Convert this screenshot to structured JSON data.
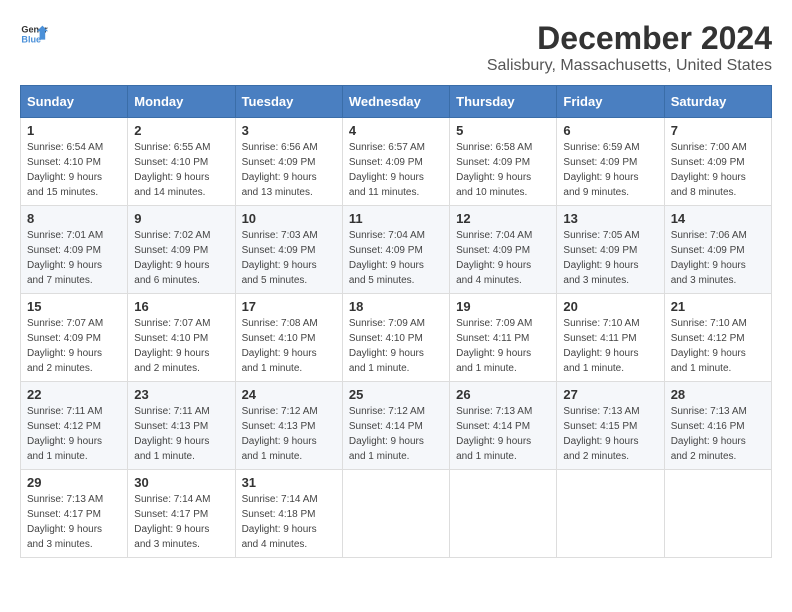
{
  "logo": {
    "line1": "General",
    "line2": "Blue"
  },
  "title": "December 2024",
  "subtitle": "Salisbury, Massachusetts, United States",
  "days_header": [
    "Sunday",
    "Monday",
    "Tuesday",
    "Wednesday",
    "Thursday",
    "Friday",
    "Saturday"
  ],
  "weeks": [
    [
      {
        "day": "1",
        "sunrise": "6:54 AM",
        "sunset": "4:10 PM",
        "daylight": "9 hours and 15 minutes."
      },
      {
        "day": "2",
        "sunrise": "6:55 AM",
        "sunset": "4:10 PM",
        "daylight": "9 hours and 14 minutes."
      },
      {
        "day": "3",
        "sunrise": "6:56 AM",
        "sunset": "4:09 PM",
        "daylight": "9 hours and 13 minutes."
      },
      {
        "day": "4",
        "sunrise": "6:57 AM",
        "sunset": "4:09 PM",
        "daylight": "9 hours and 11 minutes."
      },
      {
        "day": "5",
        "sunrise": "6:58 AM",
        "sunset": "4:09 PM",
        "daylight": "9 hours and 10 minutes."
      },
      {
        "day": "6",
        "sunrise": "6:59 AM",
        "sunset": "4:09 PM",
        "daylight": "9 hours and 9 minutes."
      },
      {
        "day": "7",
        "sunrise": "7:00 AM",
        "sunset": "4:09 PM",
        "daylight": "9 hours and 8 minutes."
      }
    ],
    [
      {
        "day": "8",
        "sunrise": "7:01 AM",
        "sunset": "4:09 PM",
        "daylight": "9 hours and 7 minutes."
      },
      {
        "day": "9",
        "sunrise": "7:02 AM",
        "sunset": "4:09 PM",
        "daylight": "9 hours and 6 minutes."
      },
      {
        "day": "10",
        "sunrise": "7:03 AM",
        "sunset": "4:09 PM",
        "daylight": "9 hours and 5 minutes."
      },
      {
        "day": "11",
        "sunrise": "7:04 AM",
        "sunset": "4:09 PM",
        "daylight": "9 hours and 5 minutes."
      },
      {
        "day": "12",
        "sunrise": "7:04 AM",
        "sunset": "4:09 PM",
        "daylight": "9 hours and 4 minutes."
      },
      {
        "day": "13",
        "sunrise": "7:05 AM",
        "sunset": "4:09 PM",
        "daylight": "9 hours and 3 minutes."
      },
      {
        "day": "14",
        "sunrise": "7:06 AM",
        "sunset": "4:09 PM",
        "daylight": "9 hours and 3 minutes."
      }
    ],
    [
      {
        "day": "15",
        "sunrise": "7:07 AM",
        "sunset": "4:09 PM",
        "daylight": "9 hours and 2 minutes."
      },
      {
        "day": "16",
        "sunrise": "7:07 AM",
        "sunset": "4:10 PM",
        "daylight": "9 hours and 2 minutes."
      },
      {
        "day": "17",
        "sunrise": "7:08 AM",
        "sunset": "4:10 PM",
        "daylight": "9 hours and 1 minute."
      },
      {
        "day": "18",
        "sunrise": "7:09 AM",
        "sunset": "4:10 PM",
        "daylight": "9 hours and 1 minute."
      },
      {
        "day": "19",
        "sunrise": "7:09 AM",
        "sunset": "4:11 PM",
        "daylight": "9 hours and 1 minute."
      },
      {
        "day": "20",
        "sunrise": "7:10 AM",
        "sunset": "4:11 PM",
        "daylight": "9 hours and 1 minute."
      },
      {
        "day": "21",
        "sunrise": "7:10 AM",
        "sunset": "4:12 PM",
        "daylight": "9 hours and 1 minute."
      }
    ],
    [
      {
        "day": "22",
        "sunrise": "7:11 AM",
        "sunset": "4:12 PM",
        "daylight": "9 hours and 1 minute."
      },
      {
        "day": "23",
        "sunrise": "7:11 AM",
        "sunset": "4:13 PM",
        "daylight": "9 hours and 1 minute."
      },
      {
        "day": "24",
        "sunrise": "7:12 AM",
        "sunset": "4:13 PM",
        "daylight": "9 hours and 1 minute."
      },
      {
        "day": "25",
        "sunrise": "7:12 AM",
        "sunset": "4:14 PM",
        "daylight": "9 hours and 1 minute."
      },
      {
        "day": "26",
        "sunrise": "7:13 AM",
        "sunset": "4:14 PM",
        "daylight": "9 hours and 1 minute."
      },
      {
        "day": "27",
        "sunrise": "7:13 AM",
        "sunset": "4:15 PM",
        "daylight": "9 hours and 2 minutes."
      },
      {
        "day": "28",
        "sunrise": "7:13 AM",
        "sunset": "4:16 PM",
        "daylight": "9 hours and 2 minutes."
      }
    ],
    [
      {
        "day": "29",
        "sunrise": "7:13 AM",
        "sunset": "4:17 PM",
        "daylight": "9 hours and 3 minutes."
      },
      {
        "day": "30",
        "sunrise": "7:14 AM",
        "sunset": "4:17 PM",
        "daylight": "9 hours and 3 minutes."
      },
      {
        "day": "31",
        "sunrise": "7:14 AM",
        "sunset": "4:18 PM",
        "daylight": "9 hours and 4 minutes."
      },
      null,
      null,
      null,
      null
    ]
  ],
  "labels": {
    "sunrise": "Sunrise:",
    "sunset": "Sunset:",
    "daylight": "Daylight:"
  }
}
